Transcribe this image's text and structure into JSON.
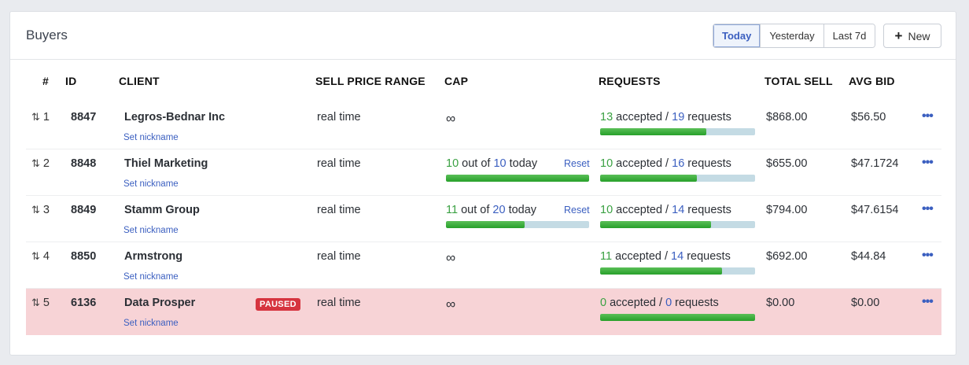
{
  "card": {
    "title": "Buyers"
  },
  "range_buttons": [
    {
      "label": "Today",
      "active": true
    },
    {
      "label": "Yesterday",
      "active": false
    },
    {
      "label": "Last 7d",
      "active": false
    }
  ],
  "new_button": {
    "label": "New",
    "icon": "plus-icon"
  },
  "columns": [
    "#",
    "ID",
    "CLIENT",
    "SELL PRICE RANGE",
    "CAP",
    "REQUESTS",
    "TOTAL SELL",
    "AVG BID"
  ],
  "colors": {
    "accent": "#3b5fc0",
    "success": "#3aa142",
    "paused_row": "#f7d3d6",
    "paused_badge": "#d6343f"
  },
  "rows": [
    {
      "rank": "1",
      "id": "8847",
      "client": "Legros-Bednar Inc",
      "nickname": "Set nickname",
      "badge": "",
      "price_range": "real time",
      "cap": {
        "infinite": true,
        "symbol": "∞"
      },
      "requests": {
        "accepted": "13",
        "accepted_label": "accepted /",
        "total": "19",
        "total_label": "requests",
        "progress": 0.684
      },
      "total_sell": "$868.00",
      "avg_bid": "$56.50",
      "paused": false
    },
    {
      "rank": "2",
      "id": "8848",
      "client": "Thiel Marketing",
      "nickname": "Set nickname",
      "badge": "",
      "price_range": "real time",
      "cap": {
        "infinite": false,
        "used": "10",
        "out_of": "out of",
        "limit": "10",
        "period": "today",
        "reset": "Reset",
        "progress": 1.0
      },
      "requests": {
        "accepted": "10",
        "accepted_label": "accepted /",
        "total": "16",
        "total_label": "requests",
        "progress": 0.625
      },
      "total_sell": "$655.00",
      "avg_bid": "$47.1724",
      "paused": false
    },
    {
      "rank": "3",
      "id": "8849",
      "client": "Stamm Group",
      "nickname": "Set nickname",
      "badge": "",
      "price_range": "real time",
      "cap": {
        "infinite": false,
        "used": "11",
        "out_of": "out of",
        "limit": "20",
        "period": "today",
        "reset": "Reset",
        "progress": 0.55
      },
      "requests": {
        "accepted": "10",
        "accepted_label": "accepted /",
        "total": "14",
        "total_label": "requests",
        "progress": 0.714
      },
      "total_sell": "$794.00",
      "avg_bid": "$47.6154",
      "paused": false
    },
    {
      "rank": "4",
      "id": "8850",
      "client": "Armstrong",
      "nickname": "Set nickname",
      "badge": "",
      "price_range": "real time",
      "cap": {
        "infinite": true,
        "symbol": "∞"
      },
      "requests": {
        "accepted": "11",
        "accepted_label": "accepted /",
        "total": "14",
        "total_label": "requests",
        "progress": 0.786
      },
      "total_sell": "$692.00",
      "avg_bid": "$44.84",
      "paused": false
    },
    {
      "rank": "5",
      "id": "6136",
      "client": "Data Prosper",
      "nickname": "Set nickname",
      "badge": "PAUSED",
      "price_range": "real time",
      "cap": {
        "infinite": true,
        "symbol": "∞"
      },
      "requests": {
        "accepted": "0",
        "accepted_label": "accepted /",
        "total": "0",
        "total_label": "requests",
        "progress": 1.0
      },
      "total_sell": "$0.00",
      "avg_bid": "$0.00",
      "paused": true
    }
  ]
}
